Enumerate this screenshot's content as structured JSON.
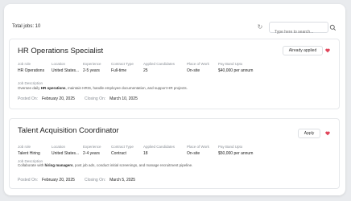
{
  "header": {
    "total_jobs": "Total jobs: 10",
    "search_placeholder": "Type here to search..."
  },
  "jobs": [
    {
      "title": "HR Operations Specialist",
      "action_label": "Already applied",
      "fields": [
        {
          "label": "Job role",
          "value": "HR Operations"
        },
        {
          "label": "Location",
          "value": "United States..."
        },
        {
          "label": "Experience",
          "value": "2-5 years"
        },
        {
          "label": "Contract Type",
          "value": "Full-time"
        },
        {
          "label": "Applied Candidates",
          "value": "25"
        },
        {
          "label": "Place of Work",
          "value": "On-site"
        },
        {
          "label": "Pay Band Upto",
          "value": "$40,000 per annum"
        }
      ],
      "description_label": "Job Description",
      "description_pre": "Oversee daily ",
      "description_bold": "HR operations",
      "description_post": ", maintain HRIS, handle employee documentation, and support HR projects.",
      "posted_label": "Posted On:",
      "posted_value": "February 20, 2025",
      "closing_label": "Closing On:",
      "closing_value": "March 10, 2025"
    },
    {
      "title": "Talent Acquisition Coordinator",
      "action_label": "Apply",
      "fields": [
        {
          "label": "Job role",
          "value": "Talent Hiring"
        },
        {
          "label": "Location",
          "value": "United States..."
        },
        {
          "label": "Experience",
          "value": "2-4 years"
        },
        {
          "label": "Contract Type",
          "value": "Contract"
        },
        {
          "label": "Applied Candidates",
          "value": "18"
        },
        {
          "label": "Place of Work",
          "value": "On-site"
        },
        {
          "label": "Pay Band Upto",
          "value": "$50,000 per annum"
        }
      ],
      "description_label": "Job Description",
      "description_pre": "Collaborate with ",
      "description_bold": "hiring managers",
      "description_post": ", post job ads, conduct initial screenings, and manage recruitment pipeline.",
      "posted_label": "Posted On:",
      "posted_value": "February 20, 2025",
      "closing_label": "Closing On:",
      "closing_value": "March 5, 2025"
    }
  ],
  "colors": {
    "background": "#e9ebee",
    "card": "#ffffff",
    "bookmark": "#e0455a",
    "muted_text": "#8a8f96"
  },
  "icons": {
    "refresh": "refresh-icon",
    "search": "search-icon",
    "bookmark": "bookmark-icon"
  }
}
